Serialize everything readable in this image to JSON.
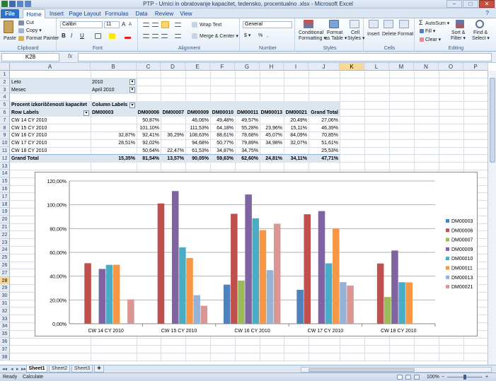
{
  "window": {
    "title": "PTP - Urnici in obratovanje kapacitet, tedensko, procentualno .xlsx - Microsoft Excel",
    "minimize": "−",
    "maximize": "□",
    "close": "✕"
  },
  "ribbon_tabs": [
    "File",
    "Home",
    "Insert",
    "Page Layout",
    "Formulas",
    "Data",
    "Review",
    "View"
  ],
  "ribbon": {
    "clipboard": {
      "paste": "Paste",
      "cut": "Cut",
      "copy": "Copy ▾",
      "format_painter": "Format Painter",
      "label": "Clipboard"
    },
    "font": {
      "name": "Calibri",
      "size": "11",
      "bold": "B",
      "italic": "I",
      "underline": "U",
      "grow": "A",
      "shrink": "A",
      "label": "Font"
    },
    "alignment": {
      "wrap": "Wrap Text",
      "merge": "Merge & Center ▾",
      "label": "Alignment"
    },
    "number": {
      "format": "General",
      "percent": "%",
      "comma": ",",
      "currency": "$ ▾",
      "label": "Number"
    },
    "styles": {
      "conditional": "Conditional",
      "conditional2": "Formatting ▾",
      "table": "Format",
      "table2": "as Table ▾",
      "cell": "Cell",
      "cell2": "Styles ▾",
      "label": "Styles"
    },
    "cells": {
      "insert": "Insert",
      "delete": "Delete",
      "format": "Format",
      "label": "Cells"
    },
    "editing": {
      "autosum": "AutoSum ▾",
      "fill": "Fill ▾",
      "clear": "Clear ▾",
      "sort": "Sort &",
      "sort2": "Filter ▾",
      "find": "Find &",
      "find2": "Select ▾",
      "label": "Editing"
    }
  },
  "formula_bar": {
    "name_box": "K28",
    "fx": "fx",
    "value": ""
  },
  "columns": [
    "A",
    "B",
    "C",
    "D",
    "E",
    "F",
    "G",
    "H",
    "I",
    "J",
    "K",
    "L",
    "M",
    "N",
    "O",
    "P"
  ],
  "rows": [
    "1",
    "2",
    "3",
    "4",
    "5",
    "6",
    "7",
    "8",
    "9",
    "10",
    "11",
    "12",
    "13",
    "14",
    "15",
    "16",
    "17",
    "18",
    "19",
    "20",
    "21",
    "22",
    "23",
    "24",
    "25",
    "26",
    "27",
    "28",
    "29",
    "30",
    "31",
    "32",
    "33",
    "34",
    "35",
    "36",
    "37",
    "38"
  ],
  "selected": {
    "col": "K",
    "row": "28"
  },
  "filters": {
    "leto_label": "Leto",
    "leto_value": "2010",
    "mesec_label": "Mesec",
    "mesec_value": "April 2010",
    "filter_icon": "▾"
  },
  "pivot": {
    "title": "Procent izkoriščenosti kapacitet",
    "column_labels": "Column Labels",
    "row_labels": "Row Labels",
    "headers": [
      "DM00003",
      "DM00006",
      "DM00007",
      "DM00009",
      "DM00010",
      "DM00011",
      "DM00013",
      "DM00021",
      "Grand Total"
    ],
    "rows": [
      {
        "label": "CW 14 CY 2010",
        "values": [
          "",
          "50,87%",
          "",
          "46,06%",
          "49,48%",
          "49,57%",
          "",
          "20,49%",
          "27,06%"
        ]
      },
      {
        "label": "CW 15 CY 2010",
        "values": [
          "",
          "101,10%",
          "",
          "111,53%",
          "64,18%",
          "55,28%",
          "23,96%",
          "15,11%",
          "46,39%"
        ]
      },
      {
        "label": "CW 16 CY 2010",
        "values": [
          "32,87%",
          "92,41%",
          "36,29%",
          "108,63%",
          "88,61%",
          "78,68%",
          "45,07%",
          "84,09%",
          "70,85%"
        ]
      },
      {
        "label": "CW 17 CY 2010",
        "values": [
          "28,51%",
          "92,02%",
          "",
          "94,68%",
          "50,77%",
          "79,89%",
          "34,98%",
          "32,07%",
          "51,61%"
        ]
      },
      {
        "label": "CW 18 CY 2010",
        "values": [
          "",
          "50,64%",
          "22,47%",
          "61,53%",
          "34,87%",
          "34,75%",
          "",
          "",
          "25,53%"
        ]
      }
    ],
    "grand_total": {
      "label": "Grand Total",
      "values": [
        "15,35%",
        "81,54%",
        "13,57%",
        "90,05%",
        "59,63%",
        "62,60%",
        "24,81%",
        "34,11%",
        "47,71%"
      ]
    }
  },
  "chart_data": {
    "type": "bar",
    "categories": [
      "CW 14 CY 2010",
      "CW 15 CY 2010",
      "CW 16 CY 2010",
      "CW 17 CY 2010",
      "CW 18 CY 2010"
    ],
    "series": [
      {
        "name": "DM00003",
        "color": "#4f81bd",
        "values": [
          null,
          null,
          32.87,
          28.51,
          null
        ]
      },
      {
        "name": "DM00006",
        "color": "#c0504d",
        "values": [
          50.87,
          101.1,
          92.41,
          92.02,
          50.64
        ]
      },
      {
        "name": "DM00007",
        "color": "#9bbb59",
        "values": [
          null,
          null,
          36.29,
          null,
          22.47
        ]
      },
      {
        "name": "DM00009",
        "color": "#8064a2",
        "values": [
          46.06,
          111.53,
          108.63,
          94.68,
          61.53
        ]
      },
      {
        "name": "DM00010",
        "color": "#4bacc6",
        "values": [
          49.48,
          64.18,
          88.61,
          50.77,
          34.87
        ]
      },
      {
        "name": "DM00011",
        "color": "#f79646",
        "values": [
          49.57,
          55.28,
          78.68,
          79.89,
          34.75
        ]
      },
      {
        "name": "DM00013",
        "color": "#95b3d7",
        "values": [
          null,
          23.96,
          45.07,
          34.98,
          null
        ]
      },
      {
        "name": "DM00021",
        "color": "#d99694",
        "values": [
          20.49,
          15.11,
          84.09,
          32.07,
          null
        ]
      }
    ],
    "ylim": [
      0,
      120
    ],
    "ytick_labels": [
      "0,00%",
      "20,00%",
      "40,00%",
      "60,00%",
      "80,00%",
      "100,00%",
      "120,00%"
    ],
    "legend": "right",
    "grid": true
  },
  "sheet_tabs": [
    "Sheet1",
    "Sheet2",
    "Sheet3"
  ],
  "status": {
    "ready": "Ready",
    "calculate": "Calculate",
    "zoom": "100%",
    "minus": "−",
    "plus": "+"
  }
}
